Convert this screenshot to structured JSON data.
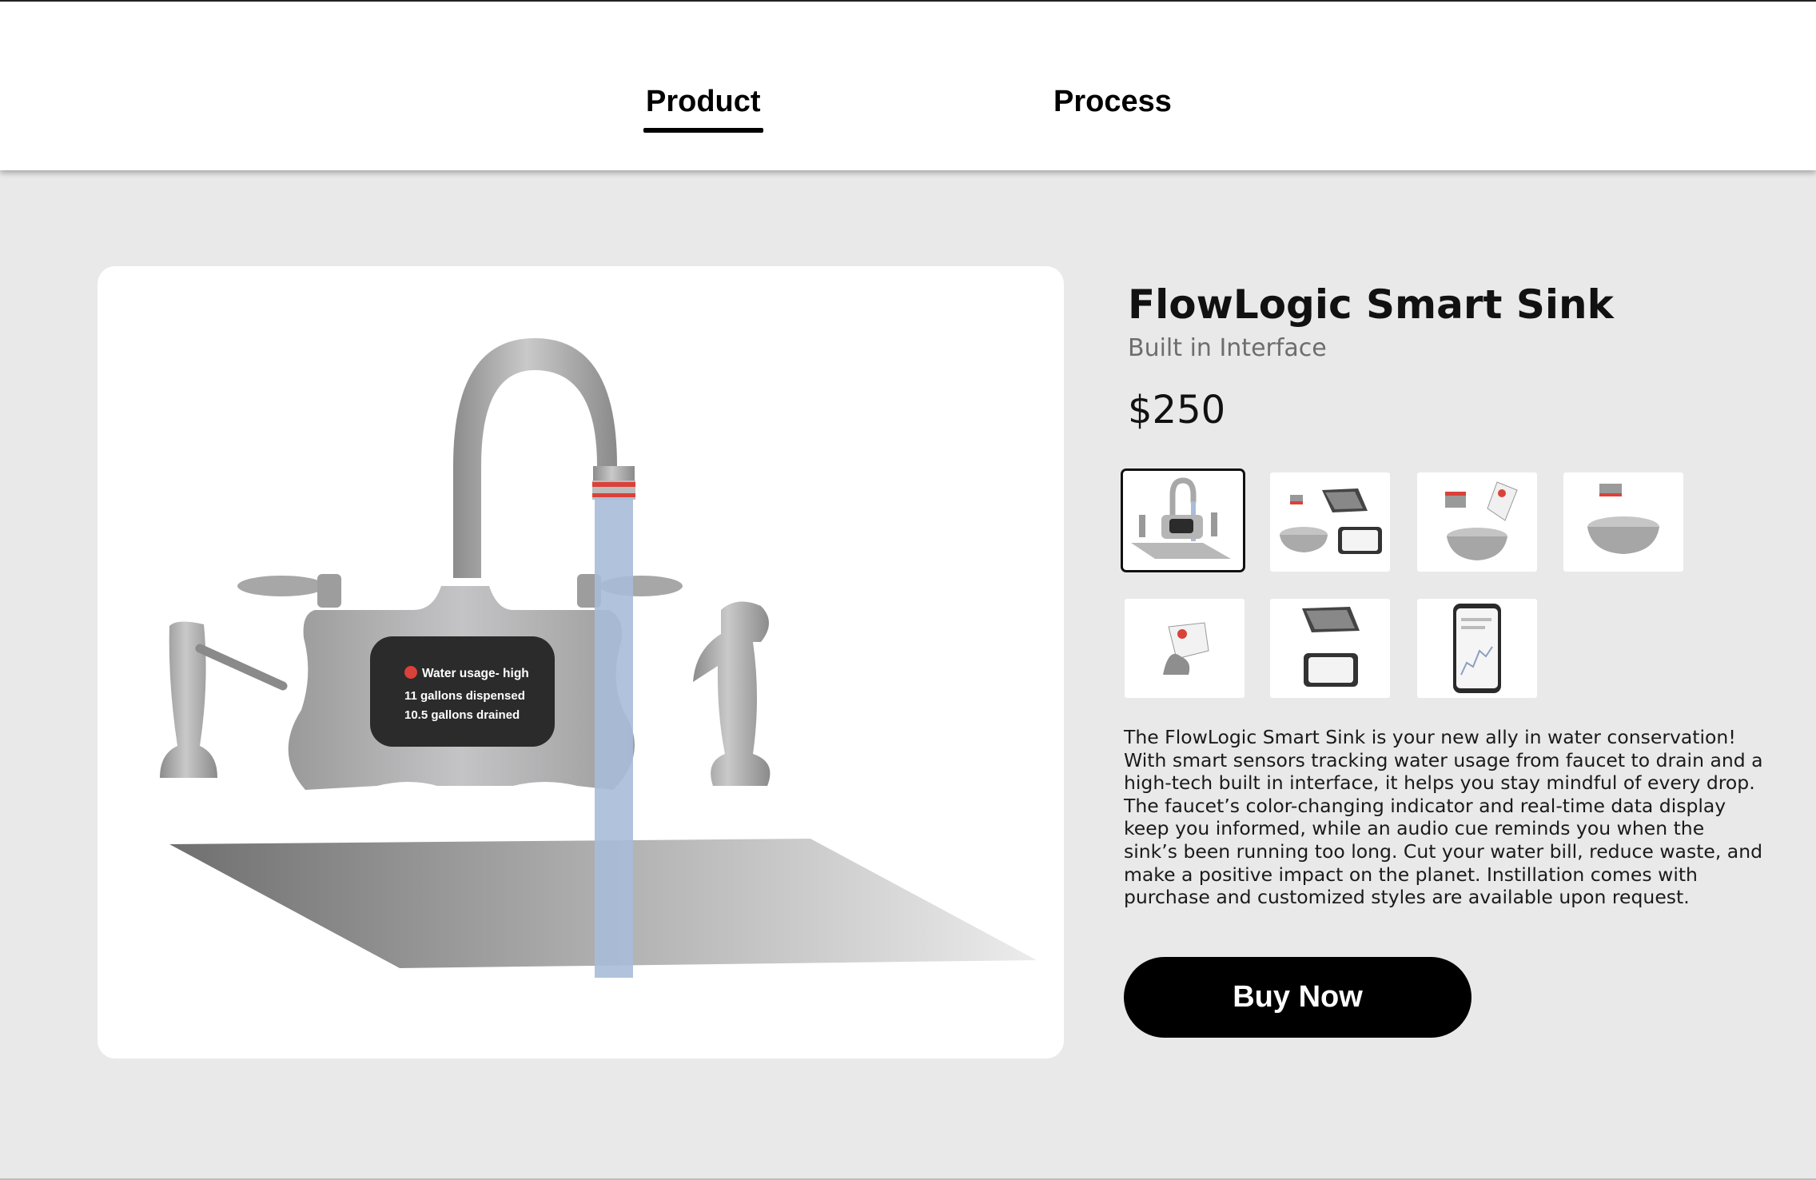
{
  "nav": {
    "tabs": [
      {
        "label": "Product",
        "active": true
      },
      {
        "label": "Process",
        "active": false
      }
    ]
  },
  "product": {
    "title": "FlowLogic Smart Sink",
    "subtitle": "Built in Interface",
    "price": "$250",
    "description": "The FlowLogic Smart Sink is your new ally in water conservation! With smart sensors tracking water usage from faucet to drain and a high-tech built in interface, it helps you stay mindful of every drop. The faucet’s color-changing indicator and real-time data display keep you informed, while an audio cue reminds you when the sink’s been running too long. Cut your water bill, reduce waste, and make a positive impact on the planet. Instillation comes with purchase and customized styles are available upon request.",
    "buy_label": "Buy Now"
  },
  "hero_display": {
    "status_line": "Water usage- high",
    "line_dispensed": "11 gallons  dispensed",
    "line_drained": "10.5 gallons drained",
    "status_color": "#d9423a"
  },
  "thumbnails": [
    {
      "name": "full-sink-view",
      "selected": true
    },
    {
      "name": "components-with-tablet",
      "selected": false
    },
    {
      "name": "sensor-rings-and-clip",
      "selected": false
    },
    {
      "name": "drain-ring",
      "selected": false
    },
    {
      "name": "faucet-clip-display",
      "selected": false
    },
    {
      "name": "tablet-and-display",
      "selected": false
    },
    {
      "name": "phone-app",
      "selected": false
    }
  ],
  "colors": {
    "background": "#e9e9e9",
    "accent": "#000000",
    "water": "#a9bcd8",
    "indicator_ring": "#d9423a"
  }
}
